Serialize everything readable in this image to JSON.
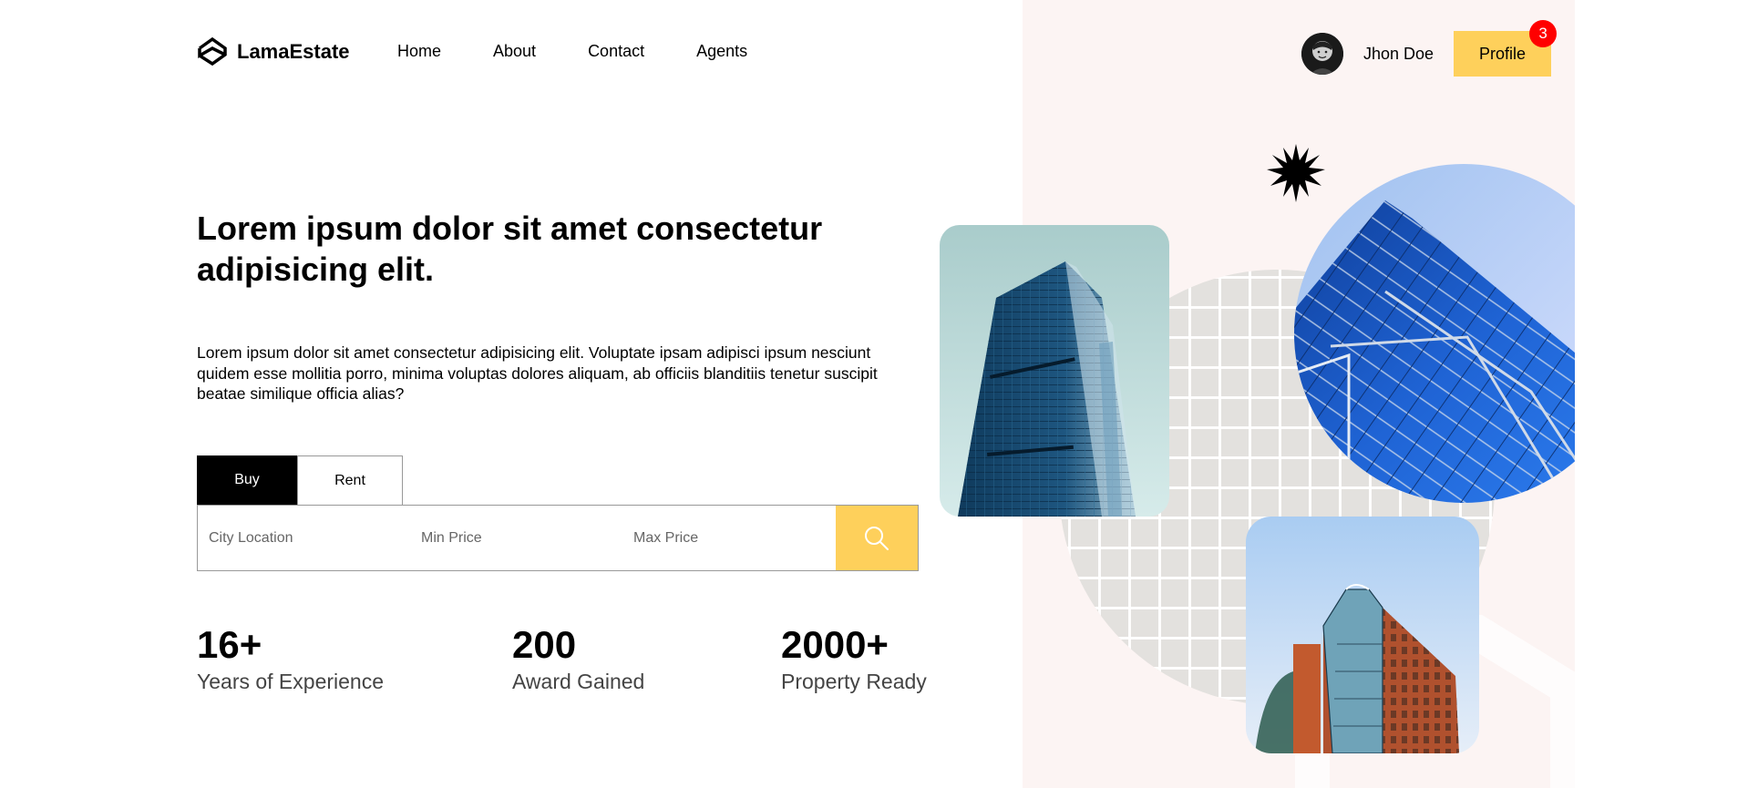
{
  "brand": {
    "name": "LamaEstate",
    "logo_icon": "logo-icon"
  },
  "nav": {
    "items": [
      {
        "label": "Home"
      },
      {
        "label": "About"
      },
      {
        "label": "Contact"
      },
      {
        "label": "Agents"
      }
    ]
  },
  "user": {
    "name": "Jhon Doe",
    "profile_label": "Profile",
    "notification_count": "3"
  },
  "hero": {
    "title": "Lorem ipsum dolor sit amet consectetur adipisicing elit.",
    "description": "Lorem ipsum dolor sit amet consectetur adipisicing elit. Voluptate ipsam adipisci ipsum nesciunt quidem esse mollitia porro, minima voluptas dolores aliquam, ab officiis blanditiis tenetur suscipit beatae similique officia alias?"
  },
  "search": {
    "tabs": [
      {
        "label": "Buy",
        "active": true
      },
      {
        "label": "Rent",
        "active": false
      }
    ],
    "fields": {
      "city_placeholder": "City Location",
      "min_price_placeholder": "Min Price",
      "max_price_placeholder": "Max Price"
    },
    "button_icon": "search-icon"
  },
  "stats": [
    {
      "value": "16+",
      "label": "Years of Experience"
    },
    {
      "value": "200",
      "label": "Award Gained"
    },
    {
      "value": "2000+",
      "label": "Property Ready"
    }
  ],
  "colors": {
    "accent": "#fed05b",
    "panel_bg": "#fcf4f3",
    "badge": "#ff0000",
    "text": "#000000"
  }
}
